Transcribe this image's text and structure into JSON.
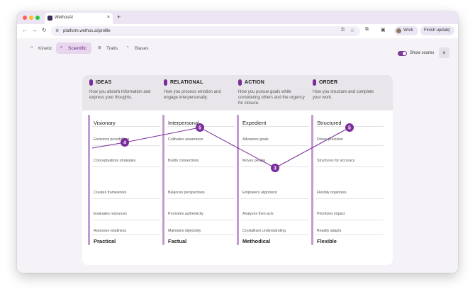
{
  "browser": {
    "tab_title": "WethosAI",
    "tab_close": "×",
    "new_tab": "+",
    "url": "platform.wethos.ai/profile",
    "profile_label": "Work",
    "finish_label": "Finish update",
    "colors": {
      "close": "#ff5f57",
      "minimize": "#febc2e",
      "zoom": "#28c840"
    }
  },
  "tabs": [
    {
      "label": "Kinetic",
      "icon": "kinetic-icon",
      "active": false
    },
    {
      "label": "Scientific",
      "icon": "chart-icon",
      "active": true
    },
    {
      "label": "Traits",
      "icon": "traits-icon",
      "active": false
    },
    {
      "label": "Biases",
      "icon": "biases-icon",
      "active": false
    }
  ],
  "controls": {
    "show_scores": "Show scores",
    "show_scores_on": true,
    "close": "×"
  },
  "categories": [
    {
      "title": "IDEAS",
      "description": "How you absorb information and express your thoughts.",
      "top": "Visionary",
      "bottom": "Practical",
      "rows": [
        "Envisions possibilities",
        "Conceptualizes strategies",
        "Creates frameworks",
        "Evaluates resources",
        "Assesses readiness"
      ],
      "score": 4
    },
    {
      "title": "RELATIONAL",
      "description": "How you process emotion and engage interpersonally.",
      "top": "Interpersonal",
      "bottom": "Factual",
      "rows": [
        "Cultivates awareness",
        "Builds connections",
        "Balances perspectives",
        "Promotes authenticity",
        "Maintains objectivity"
      ],
      "score": 5
    },
    {
      "title": "ACTION",
      "description": "How you pursue goals while considering others and the urgency for closure.",
      "top": "Expedient",
      "bottom": "Methodical",
      "rows": [
        "Advances goals",
        "Moves people",
        "Empowers alignment",
        "Analyzes then acts",
        "Crystallizes understanding"
      ],
      "score": 3
    },
    {
      "title": "ORDER",
      "description": "How you structure and complete your work.",
      "top": "Structured",
      "bottom": "Flexible",
      "rows": [
        "Drives precision",
        "Structures for accuracy",
        "Flexibly organizes",
        "Prioritizes impact",
        "Readily adapts"
      ],
      "score": 5
    }
  ],
  "colors": {
    "accent": "#7a2d9a",
    "bar": "#c39bd3",
    "highlight": "#eadcf0",
    "active_tab_bg": "#e8d5ee"
  }
}
